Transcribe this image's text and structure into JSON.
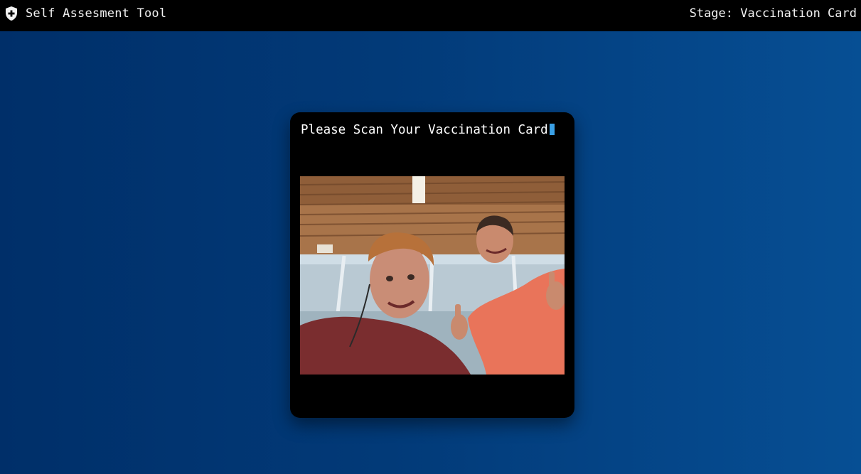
{
  "header": {
    "app_title": "Self Assesment Tool",
    "logo_icon": "shield-plus-icon",
    "stage_text": "Stage: Vaccination Card"
  },
  "main": {
    "prompt": "Please Scan Your Vaccination Card",
    "camera_feed_icon": "webcam-feed"
  },
  "colors": {
    "background_start": "#002f69",
    "background_end": "#064f94",
    "bar": "#000000",
    "card": "#000000",
    "cursor_accent": "#3aa0e6"
  }
}
